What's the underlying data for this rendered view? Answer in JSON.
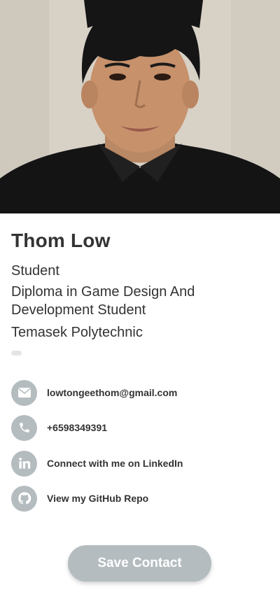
{
  "profile": {
    "name": "Thom Low",
    "title": "Student",
    "department": "Diploma in Game Design And Development Student",
    "organization": "Temasek Polytechnic"
  },
  "contacts": [
    {
      "icon": "envelope-icon",
      "label": "lowtongeethom@gmail.com"
    },
    {
      "icon": "phone-icon",
      "label": "+6598349391"
    },
    {
      "icon": "linkedin-icon",
      "label": "Connect with me on LinkedIn"
    },
    {
      "icon": "github-icon",
      "label": "View my GitHub Repo"
    }
  ],
  "actions": {
    "save_label": "Save Contact"
  },
  "colors": {
    "icon_bg": "#b4bcbf",
    "button_bg": "#b4bcbf",
    "text": "#333333"
  }
}
